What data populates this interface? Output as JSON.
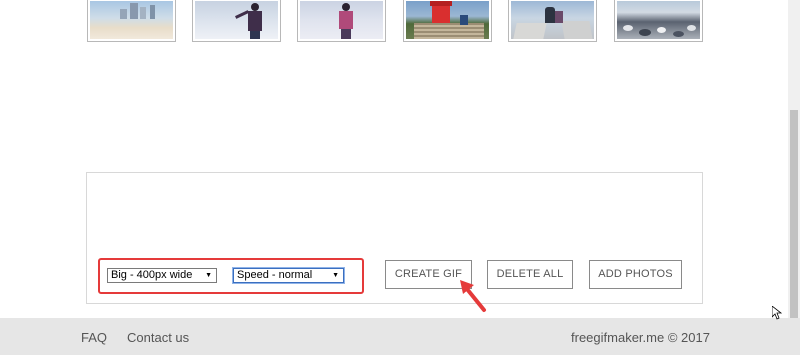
{
  "thumbnails": [
    {
      "icon": "beach-photo"
    },
    {
      "icon": "snow-person-photo"
    },
    {
      "icon": "snow-walk-photo"
    },
    {
      "icon": "lighthouse-photo"
    },
    {
      "icon": "rocks-photo"
    },
    {
      "icon": "pebbles-photo"
    }
  ],
  "controls": {
    "size_select": {
      "value": "Big - 400px wide"
    },
    "speed_select": {
      "value": "Speed - normal"
    },
    "create_gif_label": "CREATE GIF",
    "delete_all_label": "DELETE ALL",
    "add_photos_label": "ADD PHOTOS"
  },
  "footer": {
    "faq_label": "FAQ",
    "contact_label": "Contact us",
    "copyright": "freegifmaker.me  ©  2017"
  },
  "colors": {
    "highlight": "#e53a3a",
    "footer_bg": "#e6e6e6",
    "button_text": "#555555"
  }
}
